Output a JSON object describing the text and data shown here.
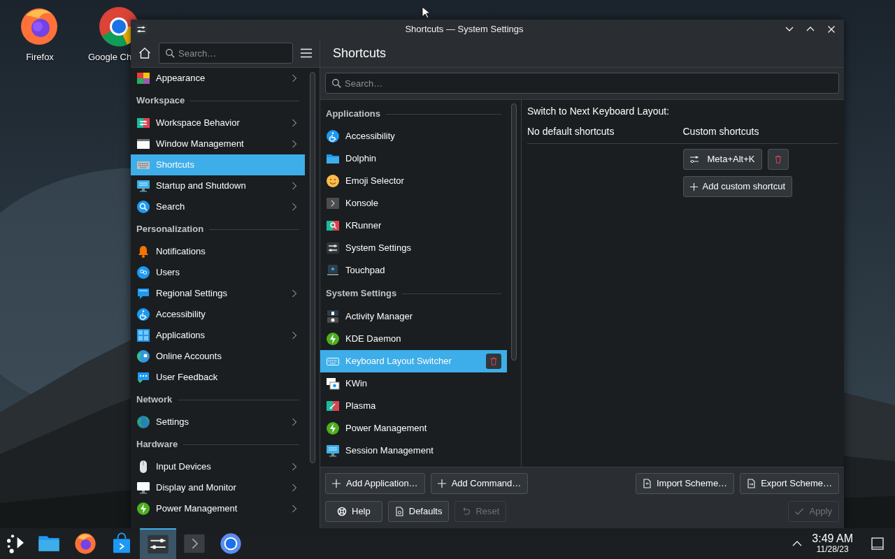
{
  "desktop": {
    "icons": [
      {
        "label": "Firefox"
      },
      {
        "label": "Google Ch"
      }
    ]
  },
  "window": {
    "title": "Shortcuts — System Settings"
  },
  "sidebar": {
    "search": {
      "placeholder": "Search…"
    },
    "sections": [
      {
        "items": [
          {
            "label": "Appearance",
            "submenu": true,
            "selected": false
          }
        ]
      },
      {
        "title": "Workspace",
        "items": [
          {
            "label": "Workspace Behavior",
            "submenu": true,
            "selected": false
          },
          {
            "label": "Window Management",
            "submenu": true,
            "selected": false
          },
          {
            "label": "Shortcuts",
            "submenu": false,
            "selected": true
          },
          {
            "label": "Startup and Shutdown",
            "submenu": true,
            "selected": false
          },
          {
            "label": "Search",
            "submenu": true,
            "selected": false
          }
        ]
      },
      {
        "title": "Personalization",
        "items": [
          {
            "label": "Notifications",
            "submenu": false,
            "selected": false
          },
          {
            "label": "Users",
            "submenu": false,
            "selected": false
          },
          {
            "label": "Regional Settings",
            "submenu": true,
            "selected": false
          },
          {
            "label": "Accessibility",
            "submenu": false,
            "selected": false
          },
          {
            "label": "Applications",
            "submenu": true,
            "selected": false
          },
          {
            "label": "Online Accounts",
            "submenu": false,
            "selected": false
          },
          {
            "label": "User Feedback",
            "submenu": false,
            "selected": false
          }
        ]
      },
      {
        "title": "Network",
        "items": [
          {
            "label": "Settings",
            "submenu": true,
            "selected": false
          }
        ]
      },
      {
        "title": "Hardware",
        "items": [
          {
            "label": "Input Devices",
            "submenu": true,
            "selected": false
          },
          {
            "label": "Display and Monitor",
            "submenu": true,
            "selected": false
          },
          {
            "label": "Power Management",
            "submenu": true,
            "selected": false
          }
        ]
      }
    ]
  },
  "page": {
    "title": "Shortcuts",
    "search": {
      "placeholder": "Search…"
    },
    "components": [
      {
        "title": "Applications",
        "items": [
          {
            "label": "Accessibility",
            "selected": false
          },
          {
            "label": "Dolphin",
            "selected": false
          },
          {
            "label": "Emoji Selector",
            "selected": false
          },
          {
            "label": "Konsole",
            "selected": false
          },
          {
            "label": "KRunner",
            "selected": false
          },
          {
            "label": "System Settings",
            "selected": false
          },
          {
            "label": "Touchpad",
            "selected": false
          }
        ]
      },
      {
        "title": "System Settings",
        "items": [
          {
            "label": "Activity Manager",
            "selected": false
          },
          {
            "label": "KDE Daemon",
            "selected": false
          },
          {
            "label": "Keyboard Layout Switcher",
            "selected": true
          },
          {
            "label": "KWin",
            "selected": false
          },
          {
            "label": "Plasma",
            "selected": false
          },
          {
            "label": "Power Management",
            "selected": false
          },
          {
            "label": "Session Management",
            "selected": false
          }
        ]
      }
    ],
    "detail": {
      "action": "Switch to Next Keyboard Layout:",
      "default_heading": "No default shortcuts",
      "custom_heading": "Custom shortcuts",
      "shortcuts": [
        {
          "keys": "Meta+Alt+K"
        }
      ],
      "add_label": "Add custom shortcut"
    },
    "actions": {
      "left": [
        {
          "label": "Add Application…",
          "disabled": false
        },
        {
          "label": "Add Command…",
          "disabled": false
        }
      ],
      "right": [
        {
          "label": "Import Scheme…",
          "disabled": false
        },
        {
          "label": "Export Scheme…",
          "disabled": false
        }
      ]
    },
    "footer": {
      "left": [
        {
          "label": "Help",
          "disabled": false
        },
        {
          "label": "Defaults",
          "disabled": false
        },
        {
          "label": "Reset",
          "disabled": true
        }
      ],
      "right": [
        {
          "label": "Apply",
          "disabled": true
        }
      ]
    }
  },
  "taskbar": {
    "items": [
      {
        "active": false
      },
      {
        "active": false
      },
      {
        "active": false
      },
      {
        "active": false
      },
      {
        "active": true
      },
      {
        "active": false
      },
      {
        "active": false
      }
    ],
    "clock": {
      "time": "3:49 AM",
      "date": "11/28/23"
    }
  }
}
